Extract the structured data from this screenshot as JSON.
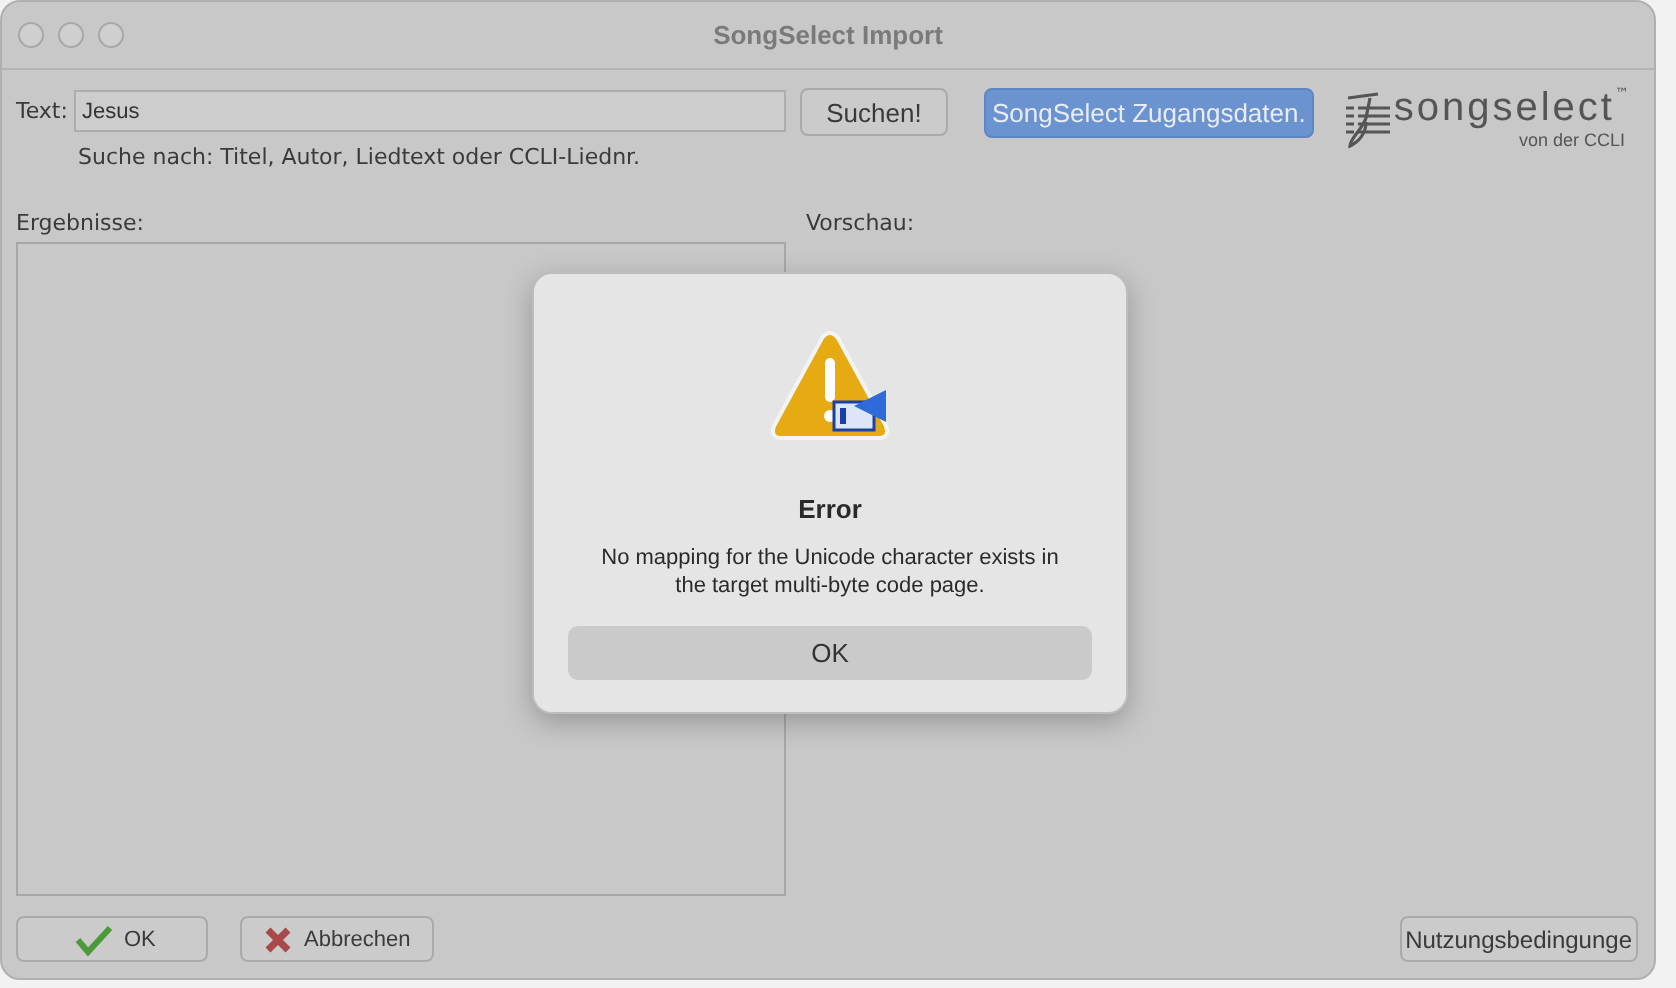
{
  "window": {
    "title": "SongSelect Import"
  },
  "search": {
    "label": "Text:",
    "value": "Jesus",
    "hint": "Suche nach: Titel, Autor, Liedtext oder CCLI-Liednr.",
    "button": "Suchen!"
  },
  "credentials_button": "SongSelect Zugangsdaten.",
  "logo": {
    "name": "songselect",
    "trademark": "™",
    "subtitle": "von der CCLI"
  },
  "results": {
    "label": "Ergebnisse:"
  },
  "preview": {
    "label": "Vorschau:"
  },
  "buttons": [
    {
      "label": "OK",
      "kind": "ok"
    },
    {
      "label": "Abbrechen",
      "kind": "cancel"
    },
    {
      "label": "Nutzungsbedingunge",
      "kind": "plain"
    }
  ],
  "dialog": {
    "title": "Error",
    "message": "No mapping for the Unicode character exists in the target multi-byte code page.",
    "button": "OK"
  }
}
